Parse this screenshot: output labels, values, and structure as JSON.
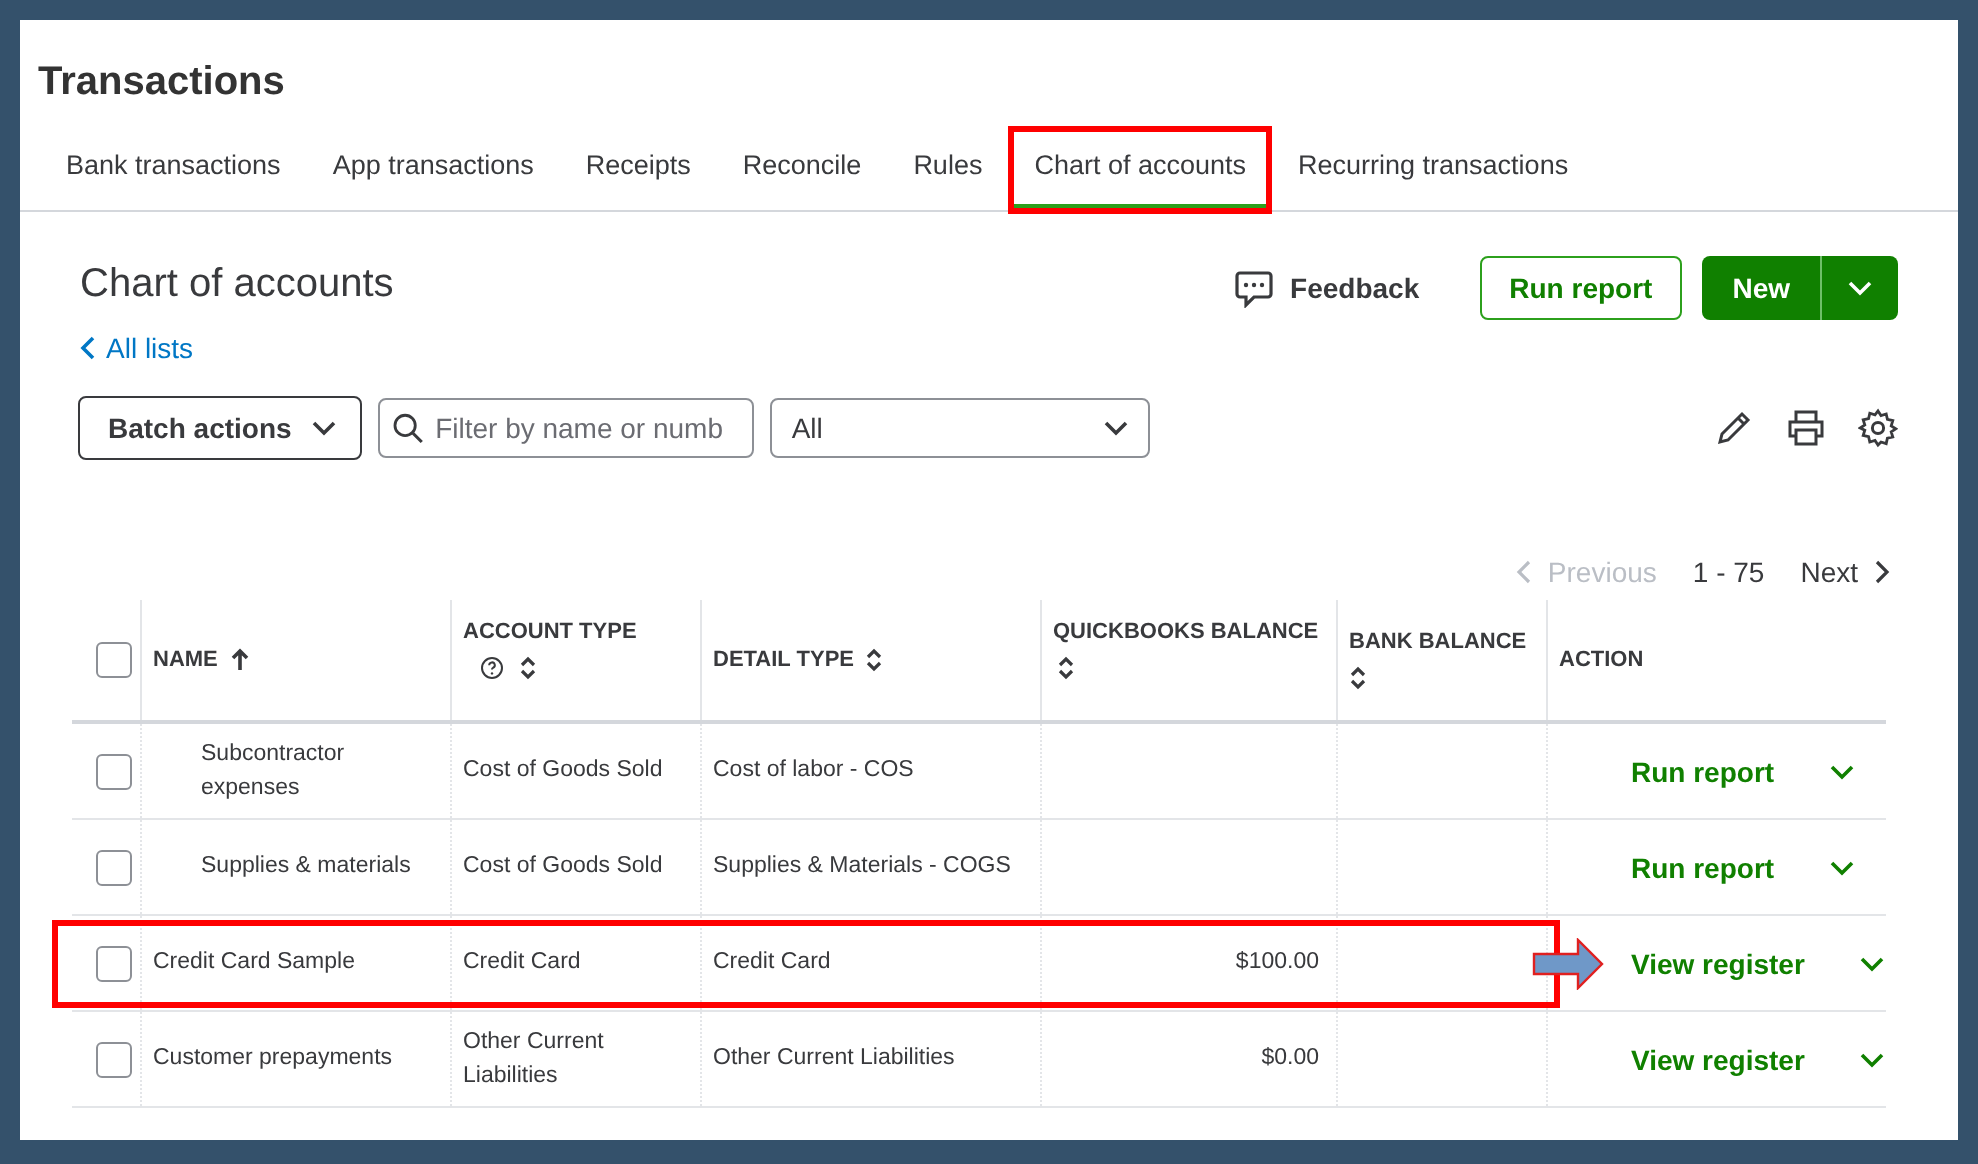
{
  "page_title": "Transactions",
  "tabs": [
    {
      "label": "Bank transactions",
      "selected": false,
      "highlighted": false
    },
    {
      "label": "App transactions",
      "selected": false,
      "highlighted": false
    },
    {
      "label": "Receipts",
      "selected": false,
      "highlighted": false
    },
    {
      "label": "Reconcile",
      "selected": false,
      "highlighted": false
    },
    {
      "label": "Rules",
      "selected": false,
      "highlighted": false
    },
    {
      "label": "Chart of accounts",
      "selected": true,
      "highlighted": true
    },
    {
      "label": "Recurring transactions",
      "selected": false,
      "highlighted": false
    }
  ],
  "heading": "Chart of accounts",
  "back_link": "All lists",
  "feedback": "Feedback",
  "run_report": "Run report",
  "new_button": "New",
  "batch_actions": "Batch actions",
  "search": {
    "placeholder": "Filter by name or numb"
  },
  "filter": {
    "value": "All"
  },
  "pagination": {
    "previous": "Previous",
    "previous_disabled": true,
    "range": "1 - 75",
    "next": "Next"
  },
  "table": {
    "select_all": {
      "checked": false
    },
    "columns": [
      {
        "label": "NAME",
        "sortable": true,
        "sorted": true,
        "help": false
      },
      {
        "label": "ACCOUNT TYPE",
        "sortable": true,
        "sorted": false,
        "help": true
      },
      {
        "label": "DETAIL TYPE",
        "sortable": true,
        "sorted": false,
        "help": false
      },
      {
        "label": "QUICKBOOKS BALANCE",
        "sortable": true,
        "sorted": false,
        "help": false
      },
      {
        "label": "BANK BALANCE",
        "sortable": true,
        "sorted": false,
        "help": false
      },
      {
        "label": "ACTION",
        "sortable": false,
        "help": false
      }
    ],
    "rows": [
      {
        "kind": "subaccount",
        "checked": false,
        "name": "Subcontractor expenses",
        "account_type": "Cost of Goods Sold",
        "detail_type": "Cost of labor - COS",
        "action": "Run report",
        "highlighted": false,
        "pointer": false
      },
      {
        "kind": "subaccount",
        "checked": false,
        "name": "Supplies & materials",
        "account_type": "Cost of Goods Sold",
        "detail_type": "Supplies & Materials - COGS",
        "action": "Run report",
        "highlighted": false,
        "pointer": false
      },
      {
        "kind": "account",
        "checked": false,
        "name": "Credit Card Sample",
        "account_type": "Credit Card",
        "detail_type": "Credit Card",
        "quickbooks_balance": "$100.00",
        "action": "View register",
        "highlighted": true,
        "pointer": true
      },
      {
        "kind": "account",
        "checked": false,
        "name": "Customer prepayments",
        "account_type": "Other Current Liabilities",
        "detail_type": "Other Current Liabilities",
        "quickbooks_balance": "$0.00",
        "action": "View register",
        "highlighted": false,
        "pointer": false
      }
    ]
  }
}
